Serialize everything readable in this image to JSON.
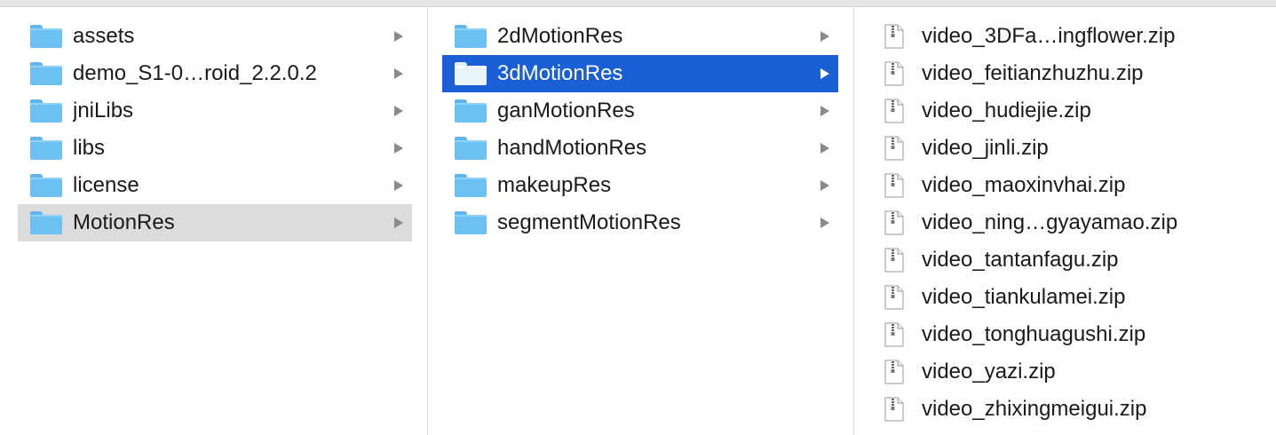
{
  "columns": [
    {
      "items": [
        {
          "label": "assets",
          "type": "folder",
          "state": "normal"
        },
        {
          "label": "demo_S1-0…roid_2.2.0.2",
          "type": "folder",
          "state": "normal"
        },
        {
          "label": "jniLibs",
          "type": "folder",
          "state": "normal"
        },
        {
          "label": "libs",
          "type": "folder",
          "state": "normal"
        },
        {
          "label": "license",
          "type": "folder",
          "state": "normal"
        },
        {
          "label": "MotionRes",
          "type": "folder",
          "state": "selected-inactive"
        }
      ]
    },
    {
      "items": [
        {
          "label": "2dMotionRes",
          "type": "folder",
          "state": "normal"
        },
        {
          "label": "3dMotionRes",
          "type": "folder",
          "state": "selected-active"
        },
        {
          "label": "ganMotionRes",
          "type": "folder",
          "state": "normal"
        },
        {
          "label": "handMotionRes",
          "type": "folder",
          "state": "normal"
        },
        {
          "label": "makeupRes",
          "type": "folder",
          "state": "normal"
        },
        {
          "label": "segmentMotionRes",
          "type": "folder",
          "state": "normal"
        }
      ]
    },
    {
      "items": [
        {
          "label": "video_3DFa…ingflower.zip",
          "type": "zip"
        },
        {
          "label": "video_feitianzhuzhu.zip",
          "type": "zip"
        },
        {
          "label": "video_hudiejie.zip",
          "type": "zip"
        },
        {
          "label": "video_jinli.zip",
          "type": "zip"
        },
        {
          "label": "video_maoxinvhai.zip",
          "type": "zip"
        },
        {
          "label": "video_ning…gyayamao.zip",
          "type": "zip"
        },
        {
          "label": "video_tantanfagu.zip",
          "type": "zip"
        },
        {
          "label": "video_tiankulamei.zip",
          "type": "zip"
        },
        {
          "label": "video_tonghuagushi.zip",
          "type": "zip"
        },
        {
          "label": "video_yazi.zip",
          "type": "zip"
        },
        {
          "label": "video_zhixingmeigui.zip",
          "type": "zip"
        }
      ]
    }
  ],
  "icons": {
    "folder": "folder-icon",
    "zip": "zip-archive-icon",
    "disclosure": "disclosure-arrow-icon"
  },
  "colors": {
    "selection_active": "#1a5fd6",
    "selection_inactive": "#dcdcdc",
    "folder": "#6cc0f2"
  }
}
